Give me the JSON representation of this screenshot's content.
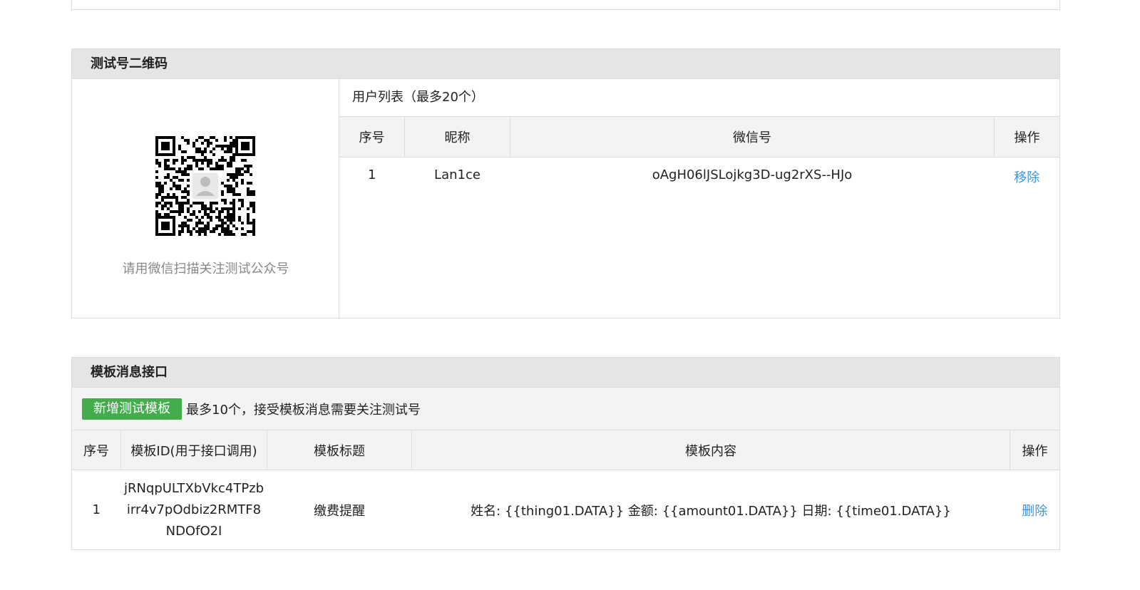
{
  "qr_panel": {
    "title": "测试号二维码",
    "caption": "请用微信扫描关注测试公众号",
    "user_list_title": "用户列表（最多20个）",
    "columns": [
      "序号",
      "昵称",
      "微信号",
      "操作"
    ],
    "rows": [
      {
        "index": "1",
        "nickname": "Lan1ce",
        "wechat_id": "oAgH06lJSLojkg3D-ug2rXS--HJo",
        "action": "移除"
      }
    ]
  },
  "template_panel": {
    "title": "模板消息接口",
    "add_button": "新增测试模板",
    "note": "最多10个，接受模板消息需要关注测试号",
    "columns": [
      "序号",
      "模板ID(用于接口调用)",
      "模板标题",
      "模板内容",
      "操作"
    ],
    "rows": [
      {
        "index": "1",
        "id_line1": "jRNqpULTXbVkc4TPzb",
        "id_line2": "irr4v7pOdbiz2RMTF8",
        "id_line3": "NDOfO2I",
        "title": "缴费提醒",
        "content": "姓名: {{thing01.DATA}} 金额: {{amount01.DATA}} 日期: {{time01.DATA}}",
        "action": "删除"
      }
    ]
  },
  "colors": {
    "link": "#3f93dc",
    "button_green": "#43ac4d",
    "header_bg": "#e5e5e5"
  }
}
